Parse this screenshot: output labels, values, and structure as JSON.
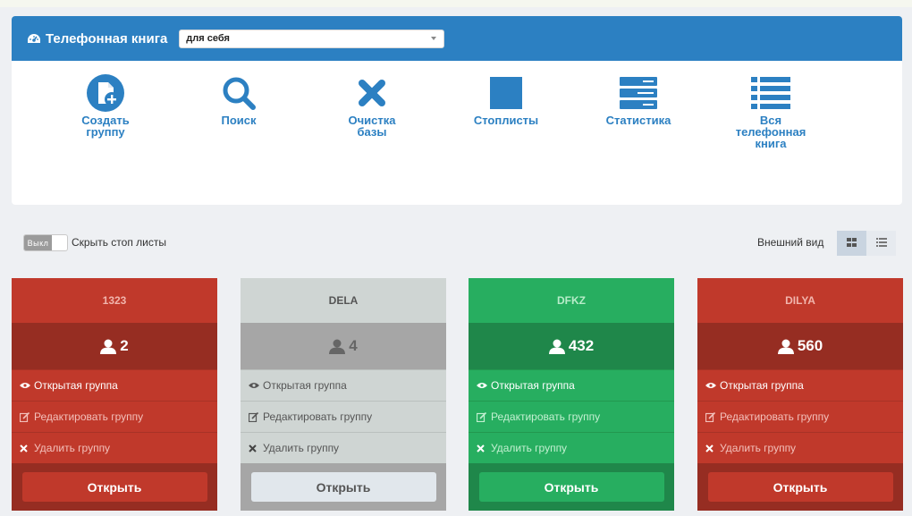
{
  "header": {
    "title": "Телефонная книга",
    "select_value": "для себя"
  },
  "tools": [
    {
      "label": "Создать группу",
      "icon": "add-document-icon"
    },
    {
      "label": "Поиск",
      "icon": "search-icon"
    },
    {
      "label": "Очистка базы",
      "icon": "close-icon"
    },
    {
      "label": "Стоплисты",
      "icon": "square-icon"
    },
    {
      "label": "Статистика",
      "icon": "server-icon"
    },
    {
      "label": "Вся телефонная книга",
      "icon": "list-icon"
    }
  ],
  "toolbar": {
    "toggle_off": "Выкл",
    "toggle_label": "Скрыть стоп листы",
    "view_label": "Внешний вид"
  },
  "cards": [
    {
      "name": "1323",
      "count": "2",
      "color": "red"
    },
    {
      "name": "DELA",
      "count": "4",
      "color": "grey"
    },
    {
      "name": "DFKZ",
      "count": "432",
      "color": "green"
    },
    {
      "name": "DILYA",
      "count": "560",
      "color": "red"
    }
  ],
  "card_actions": {
    "open_group": "Открытая группа",
    "edit_group": "Редактировать группу",
    "delete_group": "Удалить группу",
    "open_button": "Открыть"
  },
  "colors": {
    "header_blue": "#2c80c2",
    "red": "#c0392b",
    "green": "#27ae60",
    "grey": "#cfd5d3"
  }
}
